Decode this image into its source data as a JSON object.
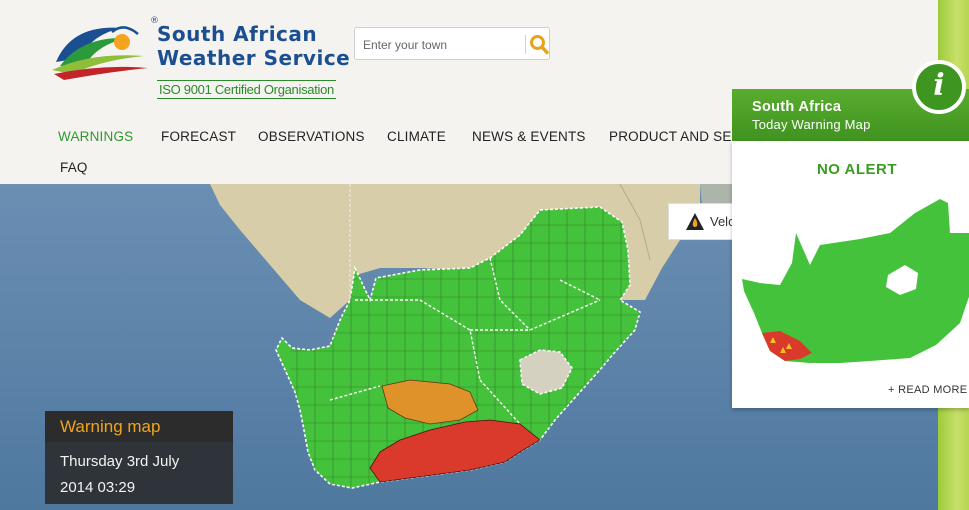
{
  "header": {
    "logo_line1": "South African",
    "logo_line2": "Weather Service",
    "logo_reg": "®",
    "logo_certification": "ISO 9001 Certified Organisation",
    "search_placeholder": "Enter your town"
  },
  "nav": {
    "items": [
      {
        "label": "WARNINGS",
        "active": true
      },
      {
        "label": "FORECAST"
      },
      {
        "label": "OBSERVATIONS"
      },
      {
        "label": "CLIMATE"
      },
      {
        "label": "NEWS & EVENTS"
      },
      {
        "label": "PRODUCT AND SERV"
      },
      {
        "label": "FAQ"
      }
    ]
  },
  "map": {
    "warning_box": {
      "title": "Warning map",
      "date": "Thursday 3rd July",
      "time": "2014 03:29"
    },
    "velocity_tab_label": "Velo",
    "colors": {
      "no_alert": "#45c23c",
      "advisory": "#e0922a",
      "warning": "#d93a2c",
      "ocean": "#5f86ad",
      "land": "#d9cfae"
    }
  },
  "panel": {
    "title": "South Africa",
    "subtitle": "Today Warning Map",
    "info_letter": "i",
    "status": "NO ALERT",
    "read_more": "+ READ MORE",
    "accent": "#3f931f"
  },
  "icons": [
    "search-icon",
    "fire-icon",
    "info-icon"
  ]
}
